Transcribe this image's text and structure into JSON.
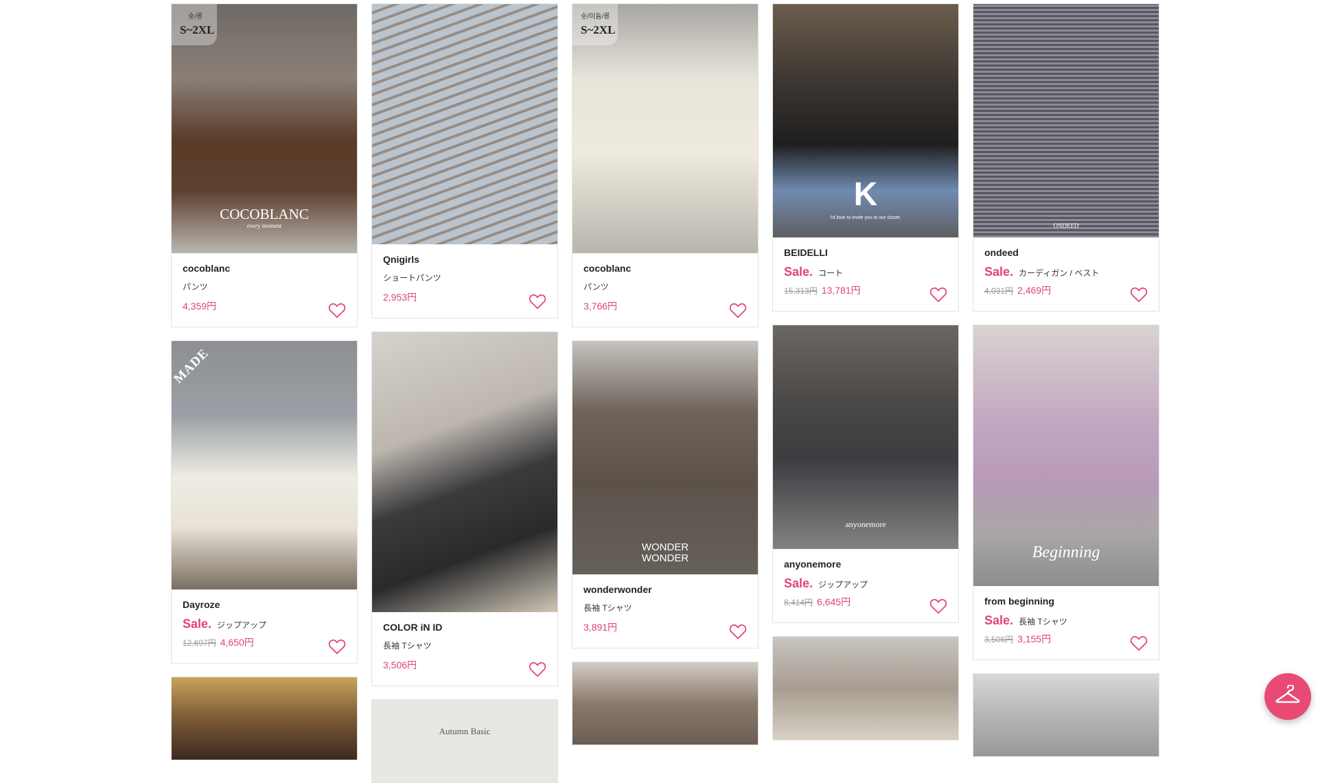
{
  "colors": {
    "accent": "#e0417f",
    "fab": "#e94a73",
    "border": "#e2e2e2"
  },
  "badges": {
    "size_range": "S~2XL",
    "length_1": "숏/롱",
    "length_2": "숏/미듐/롱",
    "made": "MADE"
  },
  "watermarks": {
    "cocoblanc": "COCOBLANC",
    "cocoblanc_sub": "every moment",
    "beidelli_tagline": "I'd love to invite you to our closet.",
    "ondeed": "ONDEED",
    "wonderwonder_1": "WONDER",
    "wonderwonder_2": "WONDER",
    "anyonemore": "anyonemore",
    "beginning": "Beginning",
    "autumn_basic": "Autumn Basic"
  },
  "products": {
    "p1": {
      "brand": "cocoblanc",
      "category": "パンツ",
      "price": "4,359円"
    },
    "p2": {
      "brand": "Qnigirls",
      "category": "ショートパンツ",
      "price": "2,953円"
    },
    "p3": {
      "brand": "cocoblanc",
      "category": "パンツ",
      "price": "3,766円"
    },
    "p4": {
      "brand": "BEIDELLI",
      "sale": "Sale.",
      "category": "コート",
      "old_price": "15,313円",
      "price": "13,781円"
    },
    "p5": {
      "brand": "ondeed",
      "sale": "Sale.",
      "category": "カーディガン / ベスト",
      "old_price": "4,031円",
      "price": "2,469円"
    },
    "p6": {
      "brand": "Dayroze",
      "sale": "Sale.",
      "category": "ジップアップ",
      "old_price": "12,697円",
      "price": "4,650円"
    },
    "p7": {
      "brand": "COLOR iN ID",
      "category": "長袖 Tシャツ",
      "price": "3,506円"
    },
    "p8": {
      "brand": "wonderwonder",
      "category": "長袖 Tシャツ",
      "price": "3,891円"
    },
    "p9": {
      "brand": "anyonemore",
      "sale": "Sale.",
      "category": "ジップアップ",
      "old_price": "8,414円",
      "price": "6,645円"
    },
    "p10": {
      "brand": "from beginning",
      "sale": "Sale.",
      "category": "長袖 Tシャツ",
      "old_price": "3,506円",
      "price": "3,155円"
    }
  },
  "icons": {
    "heart": "heart-icon",
    "fab": "hanger-icon"
  }
}
